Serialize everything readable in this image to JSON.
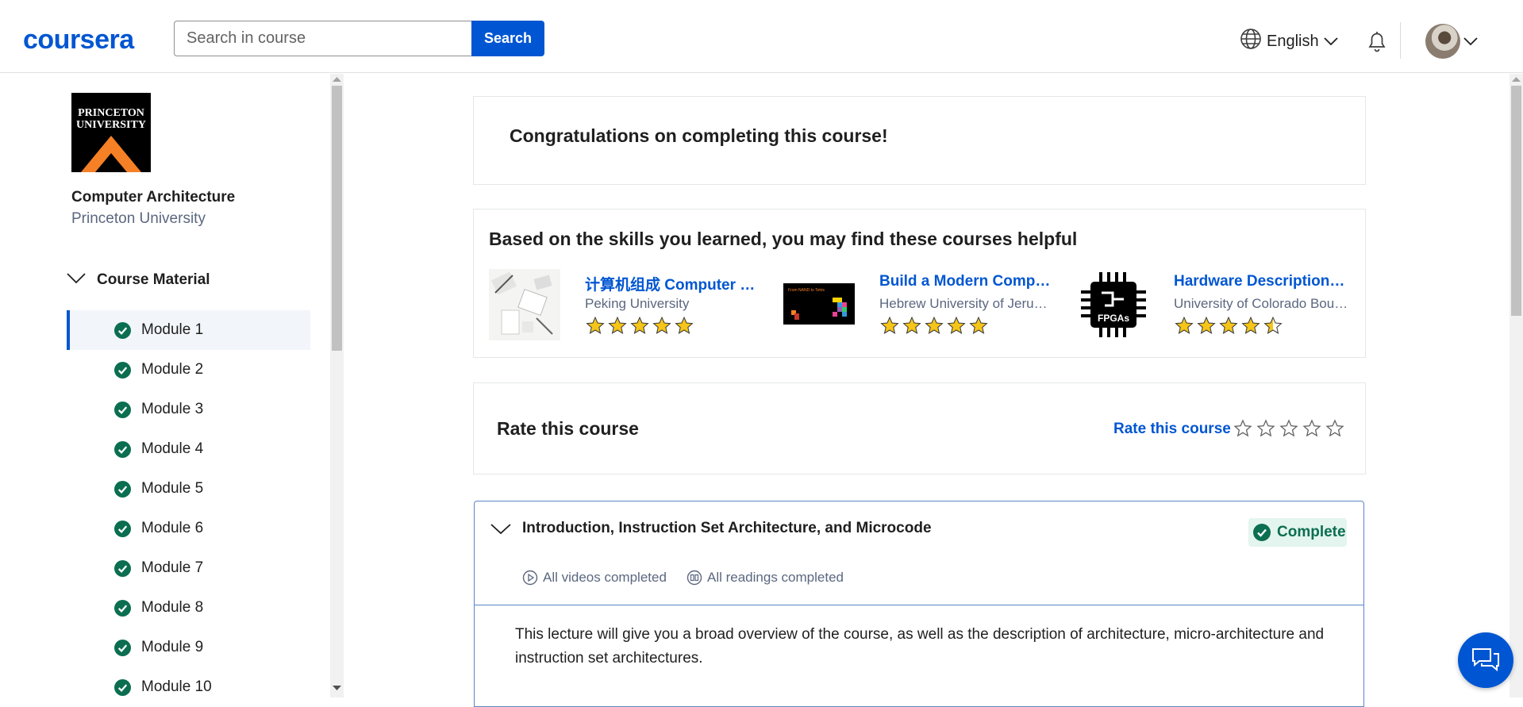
{
  "header": {
    "logo": "coursera",
    "search_placeholder": "Search in course",
    "search_button": "Search",
    "language": "English"
  },
  "sidebar": {
    "university_logo_text": "PRINCETON UNIVERSITY",
    "course_title": "Computer Architecture",
    "course_partner": "Princeton University",
    "section_label": "Course Material",
    "modules": [
      {
        "label": "Module 1",
        "active": true
      },
      {
        "label": "Module 2"
      },
      {
        "label": "Module 3"
      },
      {
        "label": "Module 4"
      },
      {
        "label": "Module 5"
      },
      {
        "label": "Module 6"
      },
      {
        "label": "Module 7"
      },
      {
        "label": "Module 8"
      },
      {
        "label": "Module 9"
      },
      {
        "label": "Module 10"
      }
    ]
  },
  "main": {
    "congrats": "Congratulations on completing this course!",
    "recommendations": {
      "title": "Based on the skills you learned, you may find these courses helpful",
      "items": [
        {
          "name": "计算机组成 Computer Organization",
          "partner": "Peking University",
          "rating": 5
        },
        {
          "name": "Build a Modern Computer from First Principles",
          "partner": "Hebrew University of Jerusalem",
          "rating": 5
        },
        {
          "name": "Hardware Description Languages for FPGA Design",
          "partner": "University of Colorado Boulder",
          "rating": 4.5
        }
      ],
      "thumb2_caption": "From NAND to Tetris",
      "thumb3_caption": "FPGAs"
    },
    "rate": {
      "title": "Rate this course",
      "link": "Rate this course",
      "stars": 0
    },
    "module_card": {
      "title": "Introduction, Instruction Set Architecture, and Microcode",
      "badge": "Complete",
      "videos": "All videos completed",
      "readings": "All readings completed",
      "description": "This lecture will give you a broad overview of the course, as well as the description of architecture, micro-architecture and instruction set architectures."
    }
  },
  "colors": {
    "brand": "#0056d2",
    "success": "#0b6e51",
    "star": "#f5c518"
  }
}
